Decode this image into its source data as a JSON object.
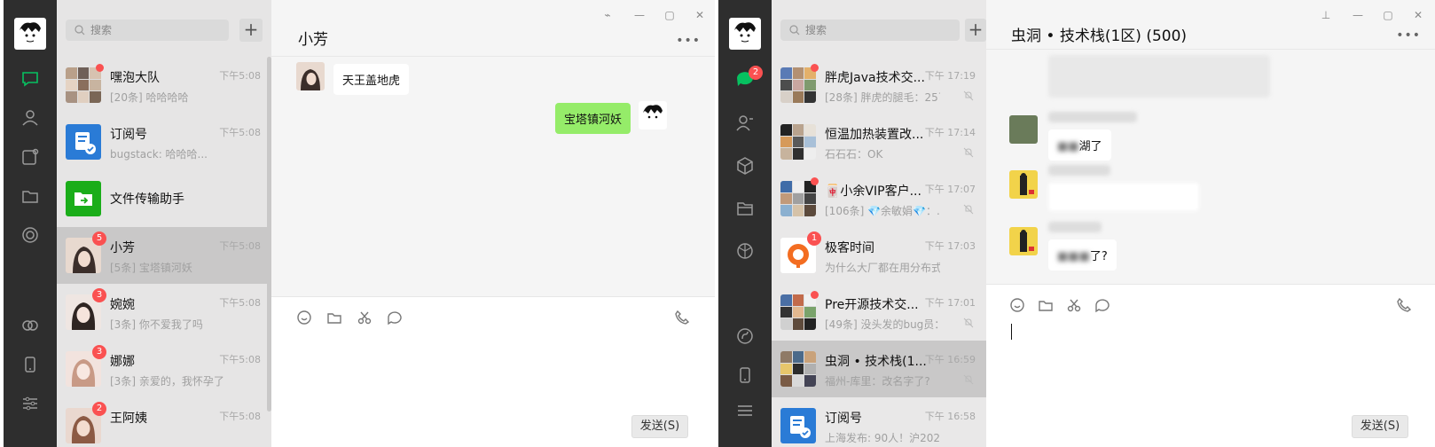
{
  "colors": {
    "accent": "#07c160",
    "badge": "#fa5151",
    "my_bubble": "#95ec69",
    "rail": "#2e2e2e"
  },
  "window1": {
    "search_placeholder": "搜索",
    "add_label": "+",
    "chat_title": "小芳",
    "more_label": "•••",
    "send_label": "发送(S)",
    "chats": [
      {
        "name": "嘿泡大队",
        "time": "下午5:08",
        "preview": "[20条] 哈哈哈哈",
        "unread_dot": true
      },
      {
        "name": "订阅号",
        "time": "下午5:08",
        "preview": "bugstack: 哈哈哈..."
      },
      {
        "name": "文件传输助手",
        "time": "",
        "preview": ""
      },
      {
        "name": "小芳",
        "time": "下午5:08",
        "preview": "[5条] 宝塔镇河妖",
        "badge": "5",
        "selected": true
      },
      {
        "name": "婉婉",
        "time": "下午5:08",
        "preview": "[3条] 你不爱我了吗",
        "badge": "3"
      },
      {
        "name": "娜娜",
        "time": "下午5:08",
        "preview": "[3条] 亲爱的，我怀孕了",
        "badge": "3"
      },
      {
        "name": "王阿姨",
        "time": "下午5:08",
        "preview": "",
        "badge": "2"
      }
    ],
    "messages": [
      {
        "from": "other",
        "text": "天王盖地虎"
      },
      {
        "from": "me",
        "text": "宝塔镇河妖"
      }
    ]
  },
  "window2": {
    "search_placeholder": "搜索",
    "add_label": "+",
    "chat_title": "虫洞 • 技术栈(1区) (500)",
    "more_label": "•••",
    "send_label": "发送(S)",
    "rail_badge": "2",
    "chats": [
      {
        "name": "胖虎Java技术交...",
        "time": "下午 17:19",
        "preview": "[28条] 胖虎的腿毛：25了",
        "unread_dot": true
      },
      {
        "name": "恒温加热装置改...",
        "time": "下午 17:14",
        "preview": "石石石：OK"
      },
      {
        "name": "🀄小余VIP客户...",
        "time": "下午 17:07",
        "preview": "[106条] 💎余敏娟💎：...",
        "unread_dot": true
      },
      {
        "name": "极客时间",
        "time": "下午 17:03",
        "preview": "为什么大厂都在用分布式...",
        "badge": "1"
      },
      {
        "name": "Pre开源技术交...",
        "time": "下午 17:01",
        "preview": "[49条] 没头发的bug员：...",
        "unread_dot": true
      },
      {
        "name": "虫洞 • 技术栈(1...",
        "time": "下午 16:59",
        "preview": "福州-库里：改名字了?",
        "selected": true
      },
      {
        "name": "订阅号",
        "time": "下午 16:58",
        "preview": "上海发布: 90人！沪2020..."
      }
    ],
    "messages": [
      {
        "from": "other",
        "text": "湖了"
      },
      {
        "from": "other",
        "text": ""
      },
      {
        "from": "other",
        "text": "了?"
      }
    ]
  }
}
